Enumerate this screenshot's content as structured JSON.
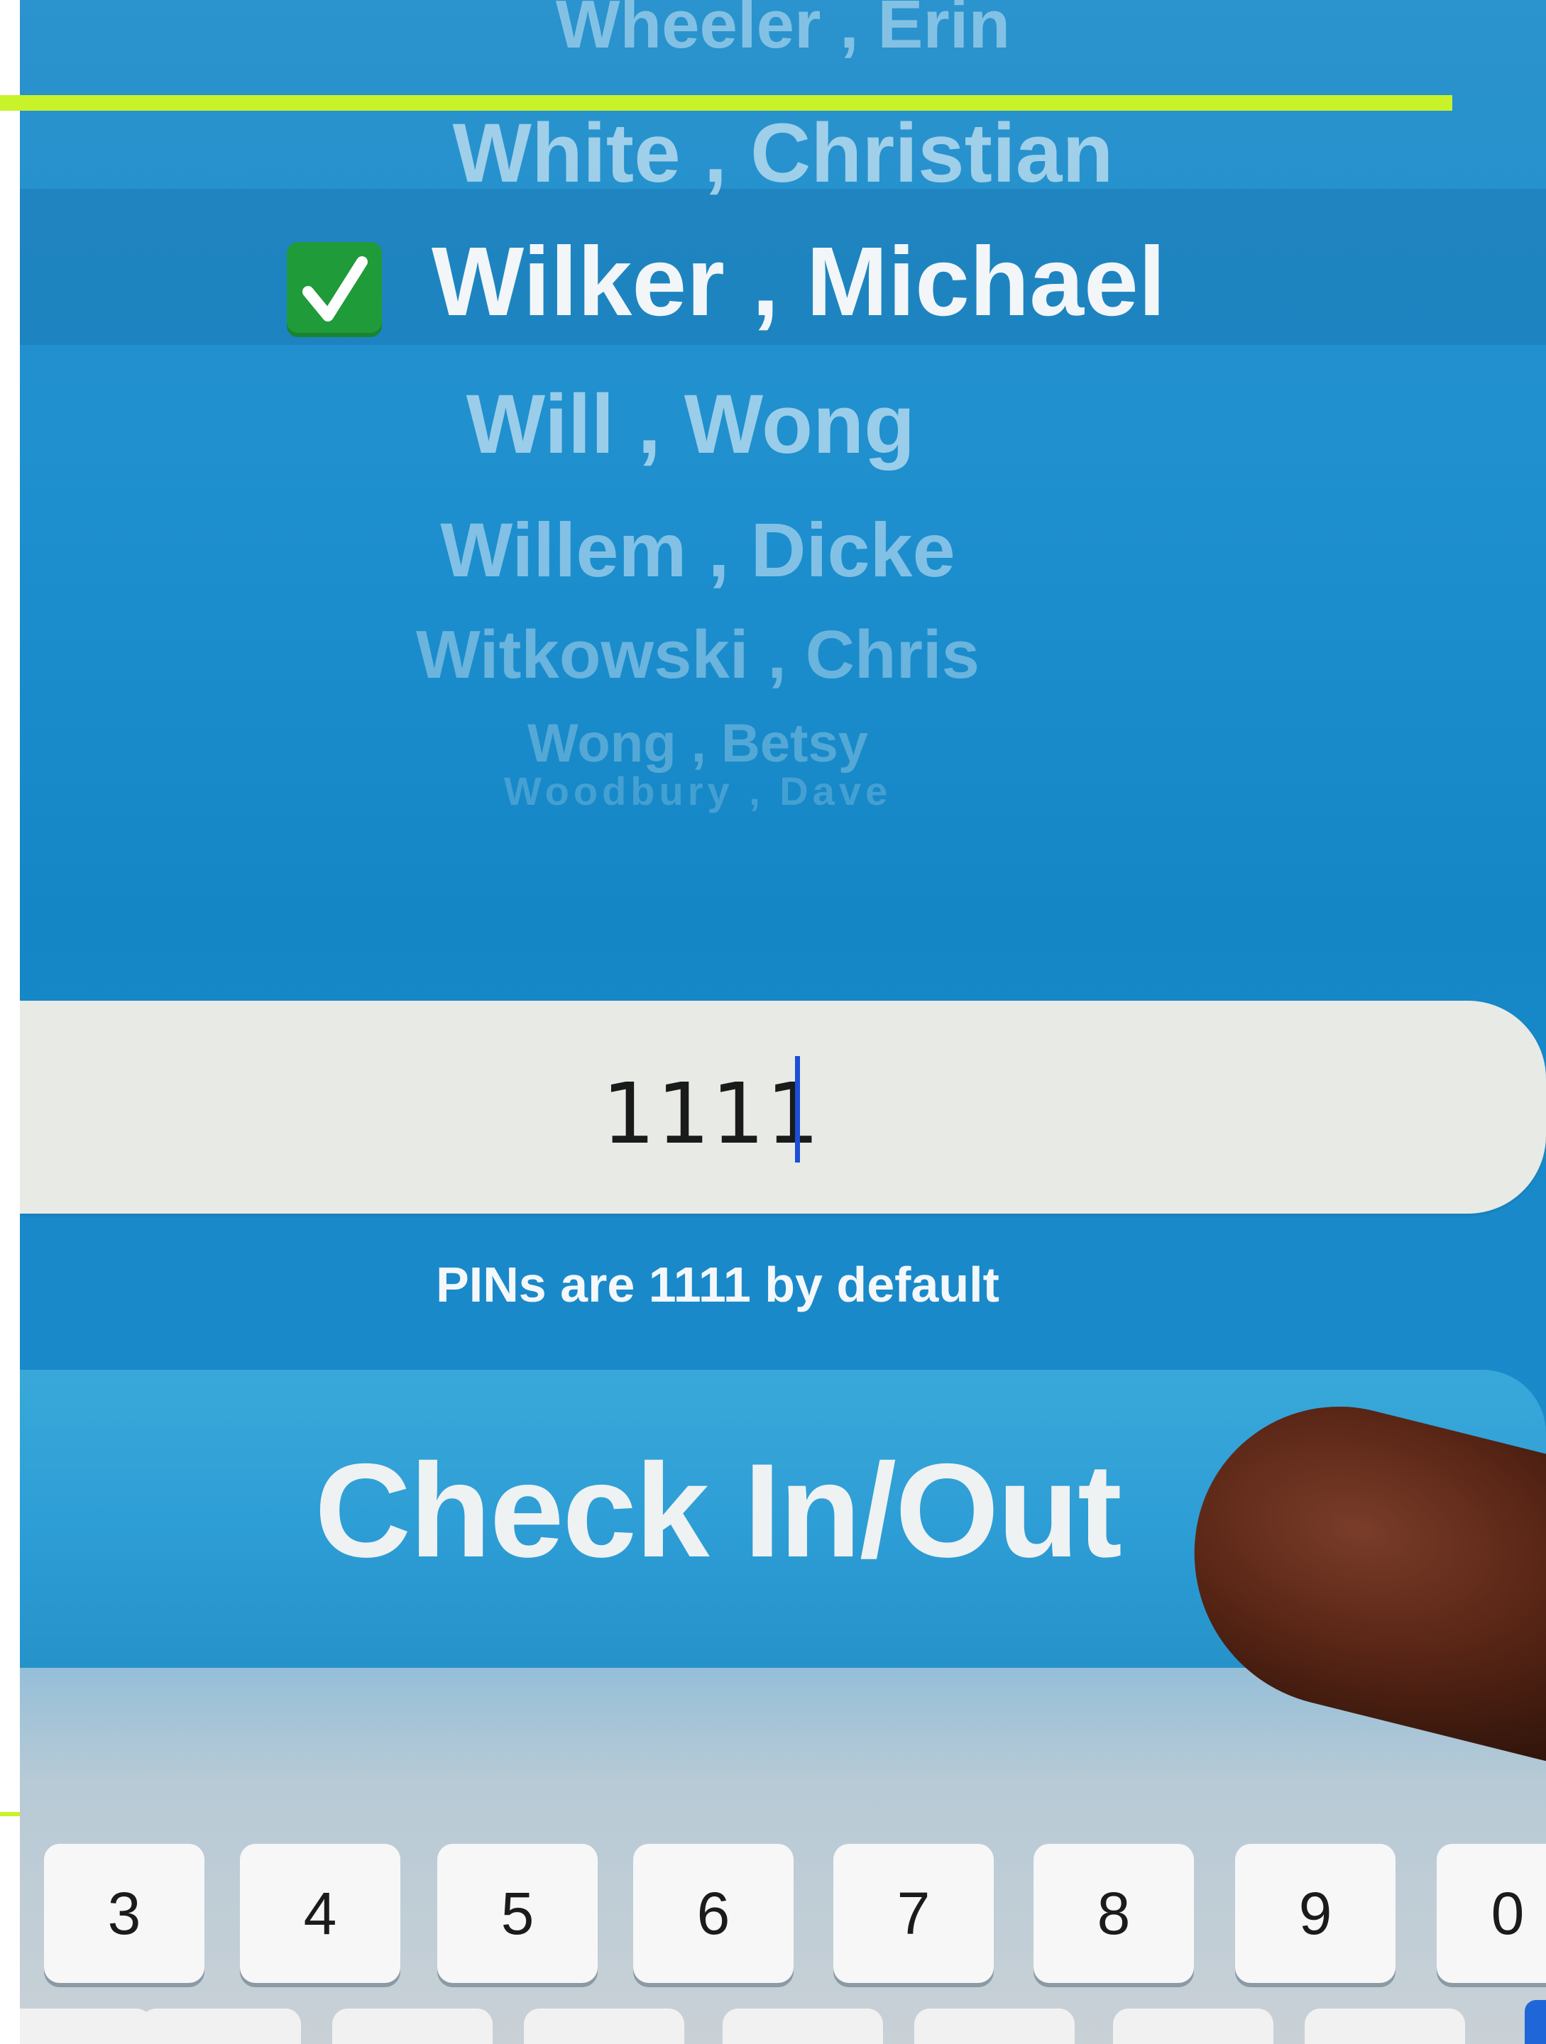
{
  "picker": {
    "rows": [
      {
        "label": "Wheeler , Erin"
      },
      {
        "label": "White , Christian"
      },
      {
        "label": "Wilker , Michael"
      },
      {
        "label": "Will , Wong"
      },
      {
        "label": "Willem , Dicke"
      },
      {
        "label": "Witkowski , Chris"
      },
      {
        "label": "Wong , Betsy"
      },
      {
        "label": "Woodbury , Dave"
      }
    ],
    "selected_index": 2
  },
  "pin": {
    "value": "1111",
    "hint": "PINs are 1111 by default"
  },
  "action": {
    "label": "Check In/Out"
  },
  "keyboard": {
    "digits": [
      "3",
      "4",
      "5",
      "6",
      "7",
      "8",
      "9",
      "0"
    ]
  },
  "colors": {
    "screen_blue": "#1e8fce",
    "highlight_line": "#c8f22a",
    "check_green": "#1f9b3a",
    "caret": "#1a4fd6"
  },
  "icons": {
    "selected_marker": "check-mark-icon"
  }
}
